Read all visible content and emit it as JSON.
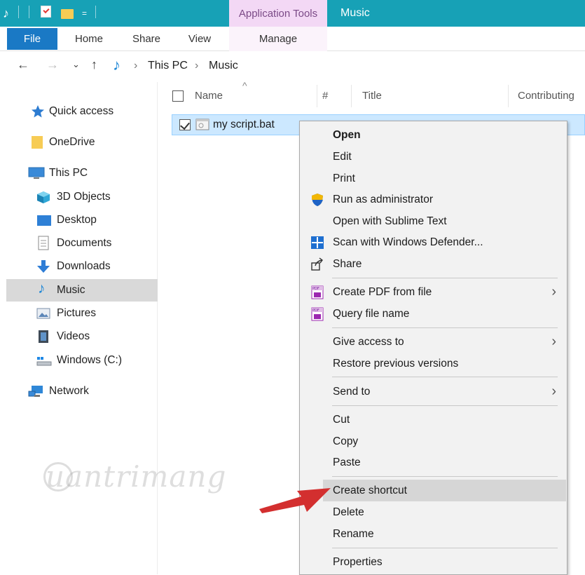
{
  "titlebar": {
    "quick_access_dropdown": "=",
    "context_tab": "Application Tools",
    "window_title": "Music"
  },
  "ribbon": {
    "tabs": [
      "File",
      "Home",
      "Share",
      "View",
      "Manage"
    ]
  },
  "address": {
    "back": "←",
    "forward": "→",
    "recent": "⌄",
    "up": "↑",
    "crumb_sep": "›",
    "crumbs": [
      "This PC",
      "Music"
    ]
  },
  "sidebar": {
    "items": [
      {
        "label": "Quick access",
        "icon": "star-icon"
      },
      {
        "label": "OneDrive",
        "icon": "folder-icon"
      },
      {
        "label": "This PC",
        "icon": "monitor-icon"
      },
      {
        "label": "3D Objects",
        "icon": "cube-icon"
      },
      {
        "label": "Desktop",
        "icon": "desktop-icon"
      },
      {
        "label": "Documents",
        "icon": "document-icon"
      },
      {
        "label": "Downloads",
        "icon": "download-icon"
      },
      {
        "label": "Music",
        "icon": "music-icon",
        "selected": true
      },
      {
        "label": "Pictures",
        "icon": "picture-icon"
      },
      {
        "label": "Videos",
        "icon": "film-icon"
      },
      {
        "label": "Windows (C:)",
        "icon": "drive-icon"
      },
      {
        "label": "Network",
        "icon": "network-icon"
      }
    ]
  },
  "file_list": {
    "columns": [
      "Name",
      "#",
      "Title",
      "Contributing"
    ],
    "sort_indicator": "^",
    "rows": [
      {
        "name": "my script.bat",
        "checked": true
      }
    ]
  },
  "context_menu": {
    "items": [
      {
        "label": "Open",
        "bold": true
      },
      {
        "label": "Edit"
      },
      {
        "label": "Print"
      },
      {
        "label": "Run as administrator",
        "icon": "shield-icon"
      },
      {
        "label": "Open with Sublime Text"
      },
      {
        "label": "Scan with Windows Defender...",
        "icon": "defender-icon"
      },
      {
        "label": "Share",
        "icon": "share-icon"
      },
      {
        "label": "Create PDF from file",
        "icon": "pdf-icon",
        "submenu": true
      },
      {
        "label": "Query file name",
        "icon": "pdf-icon"
      },
      {
        "label": "Give access to",
        "submenu": true
      },
      {
        "label": "Restore previous versions"
      },
      {
        "label": "Send to",
        "submenu": true
      },
      {
        "label": "Cut"
      },
      {
        "label": "Copy"
      },
      {
        "label": "Paste"
      },
      {
        "label": "Create shortcut",
        "highlighted": true
      },
      {
        "label": "Delete"
      },
      {
        "label": "Rename"
      },
      {
        "label": "Properties"
      }
    ],
    "submenu_arrow": "›"
  },
  "watermark": {
    "text": "uantrimang"
  },
  "colors": {
    "titlebar": "#17a1b6",
    "file_tab": "#1a79c5",
    "context_tab_bg": "#f3d8f5",
    "selection": "#cce8ff",
    "menu_bg": "#f2f2f2",
    "menu_highlight": "#d6d6d6",
    "arrow": "#d32f2f"
  }
}
